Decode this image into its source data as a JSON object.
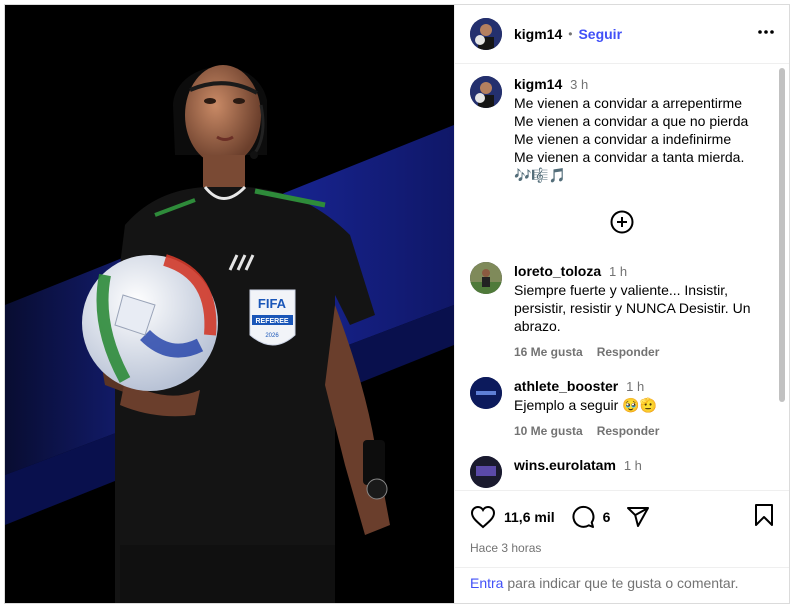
{
  "post": {
    "author": "kigm14",
    "follow_label": "Seguir",
    "more_icon": "more-icon",
    "caption": {
      "username": "kigm14",
      "time": "3 h",
      "lines": [
        "Me vienen a convidar a arrepentirme",
        "Me vienen a convidar a que no pierda",
        "Me vienen a convidar a indefinirme",
        "Me vienen a convidar a tanta mierda.",
        "🎶🎼🎵"
      ]
    },
    "comments": [
      {
        "username": "loreto_toloza",
        "time": "1 h",
        "text": "Siempre fuerte y valiente... Insistir, persistir, resistir y NUNCA Desistir. Un abrazo.",
        "likes": "16 Me gusta",
        "reply": "Responder"
      },
      {
        "username": "athlete_booster",
        "time": "1 h",
        "text": "Ejemplo a seguir 🥹🫡",
        "likes": "10 Me gusta",
        "reply": "Responder"
      },
      {
        "username": "wins.eurolatam",
        "time": "1 h",
        "text": "",
        "likes": "",
        "reply": ""
      }
    ],
    "likes_count": "11,6 mil",
    "comments_count": "6",
    "posted_ago": "Hace 3 horas",
    "login_link": "Entra",
    "login_text": " para indicar que te gusta o comentar."
  },
  "media": {
    "badge_title": "FIFA",
    "badge_sub": "REFEREE",
    "badge_year": "2026",
    "colors": {
      "background": "#000000",
      "blue_light": "#1f2fb8",
      "shirt": "#141414",
      "accent_green": "#2e8b3a"
    }
  },
  "colors": {
    "link": "#4150f7",
    "muted": "#737373",
    "border": "#efefef"
  }
}
